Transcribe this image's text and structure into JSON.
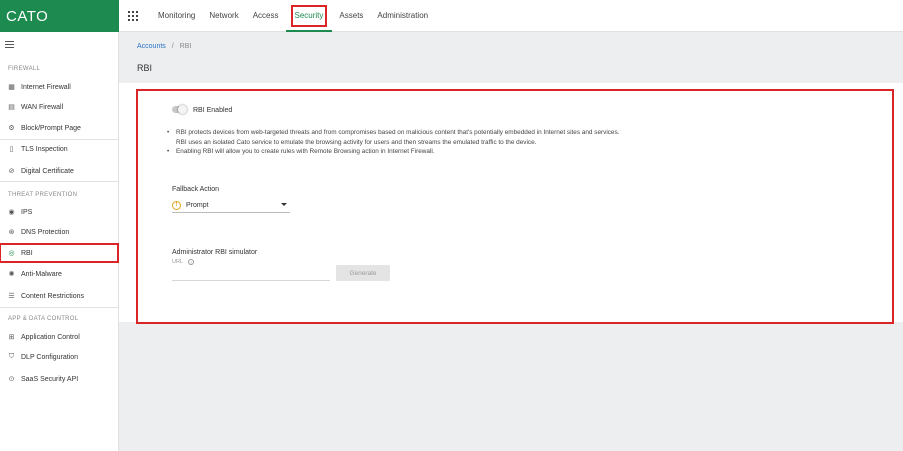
{
  "brand": {
    "logo_text": "CATO",
    "color": "#1d8a4f"
  },
  "topnav": {
    "items": [
      {
        "label": "Monitoring"
      },
      {
        "label": "Network"
      },
      {
        "label": "Access"
      },
      {
        "label": "Security"
      },
      {
        "label": "Assets"
      },
      {
        "label": "Administration"
      }
    ],
    "active": "Security"
  },
  "sidebar": {
    "sections": [
      {
        "title": "FIREWALL",
        "items": [
          "Internet Firewall",
          "WAN Firewall",
          "Block/Prompt Page",
          "TLS Inspection",
          "Digital Certificate"
        ]
      },
      {
        "title": "THREAT PREVENTION",
        "items": [
          "IPS",
          "DNS Protection",
          "RBI",
          "Anti-Malware",
          "Content Restrictions"
        ]
      },
      {
        "title": "APP & DATA CONTROL",
        "items": [
          "Application Control",
          "DLP Configuration",
          "SaaS Security API"
        ]
      }
    ],
    "selected": "RBI"
  },
  "breadcrumb": {
    "link": "Accounts",
    "separator": "/",
    "current": "RBI"
  },
  "page_title": "RBI",
  "rbi": {
    "toggle_label": "RBI Enabled",
    "enabled": false,
    "bullets": [
      "RBI protects devices from web-targeted threats and from compromises based on malicious content that's potentially embedded in Internet sites and services.",
      "RBI uses an isolated Cato service to emulate the browsing activity for users and then streams the emulated traffic to the device.",
      "Enabling RBI will allow you to create rules with Remote Browsing action in Internet Firewall."
    ],
    "fallback_label": "Fallback Action",
    "fallback_value": "Prompt",
    "simulator_label": "Administrator RBI simulator",
    "url_label": "URL",
    "url_value": "",
    "generate_label": "Generate"
  },
  "colors": {
    "highlight": "#d92525",
    "link": "#2a73c5",
    "warning": "#e2a21a"
  }
}
